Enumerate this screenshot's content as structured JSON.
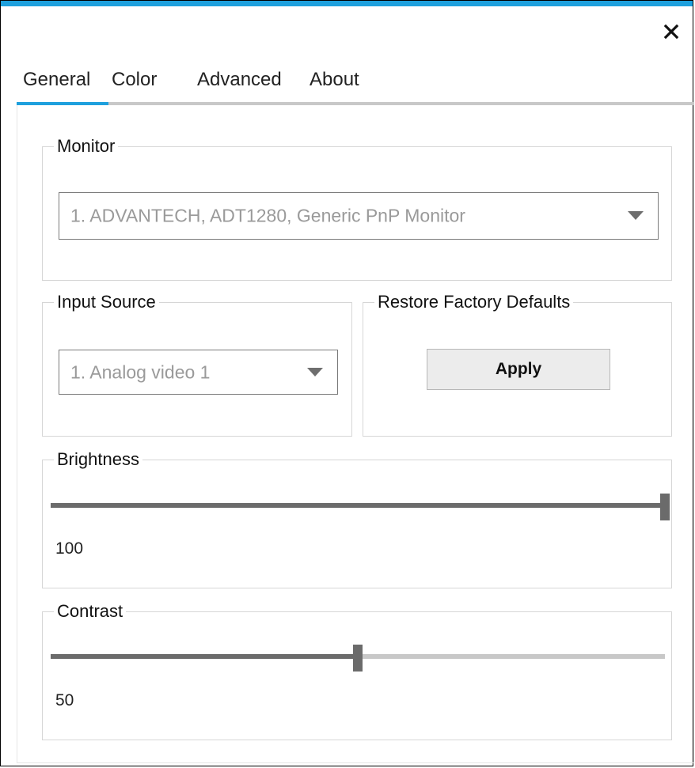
{
  "window": {
    "accent_color": "#1ea0dd",
    "close_icon": "close-icon"
  },
  "tabs": [
    {
      "label": "General",
      "active": true
    },
    {
      "label": "Color",
      "active": false
    },
    {
      "label": "Advanced",
      "active": false
    },
    {
      "label": "About",
      "active": false
    }
  ],
  "monitor": {
    "label": "Monitor",
    "selected": "1. ADVANTECH, ADT1280, Generic PnP Monitor"
  },
  "input_source": {
    "label": "Input Source",
    "selected": "1. Analog video 1"
  },
  "restore_defaults": {
    "label": "Restore Factory Defaults",
    "button_label": "Apply"
  },
  "brightness": {
    "label": "Brightness",
    "value": 100,
    "value_text": "100",
    "min": 0,
    "max": 100
  },
  "contrast": {
    "label": "Contrast",
    "value": 50,
    "value_text": "50",
    "min": 0,
    "max": 100
  }
}
